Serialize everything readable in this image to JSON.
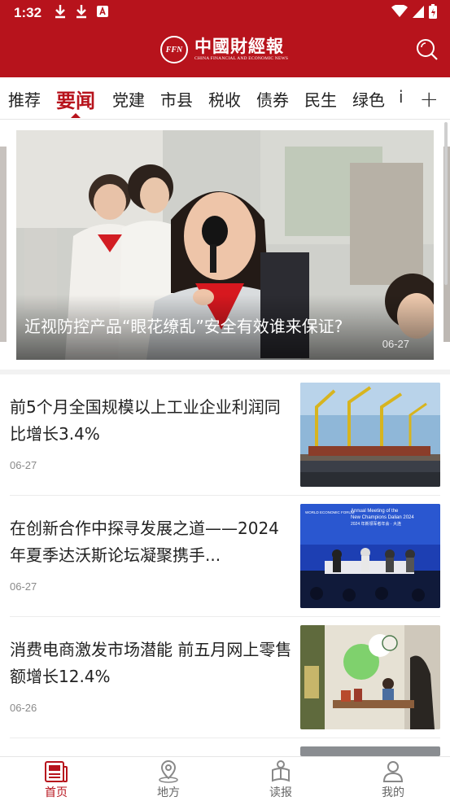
{
  "status_bar": {
    "time": "1:32"
  },
  "header": {
    "logo_seal": "FFN",
    "logo_cn": "中國財經報",
    "logo_en": "CHINA FINANCIAL AND ECONOMIC NEWS"
  },
  "tabs": {
    "items": [
      "推荐",
      "要闻",
      "党建",
      "市县",
      "税收",
      "债券",
      "民生",
      "绿色",
      "i"
    ],
    "active_index": 1,
    "add_label": "+"
  },
  "carousel": {
    "title": "近视防控产品“眼花缭乱”安全有效谁来保证?",
    "date": "06-27"
  },
  "news": [
    {
      "title": "前5个月全国规模以上工业企业利润同比增长3.4%",
      "date": "06-27",
      "thumb": "port-cranes-image"
    },
    {
      "title": "在创新合作中探寻发展之道——2024年夏季达沃斯论坛凝聚携手...",
      "date": "06-27",
      "thumb": "forum-stage-image",
      "thumb_text": [
        "WORLD ECONOMIC FORUM",
        "Annual Meeting of the",
        "New Champions Dalian 2024",
        "2024 年新领军者年会 · 大连"
      ]
    },
    {
      "title": "消费电商激发市场潜能 前五月网上零售额增长12.4%",
      "date": "06-26",
      "thumb": "livestream-image"
    }
  ],
  "bottom_nav": {
    "items": [
      {
        "label": "首页",
        "icon": "news-icon"
      },
      {
        "label": "地方",
        "icon": "location-icon"
      },
      {
        "label": "读报",
        "icon": "reader-icon"
      },
      {
        "label": "我的",
        "icon": "person-icon"
      }
    ],
    "active_index": 0
  },
  "colors": {
    "brand": "#b7131c",
    "text": "#222222",
    "muted": "#8a8a8a"
  }
}
